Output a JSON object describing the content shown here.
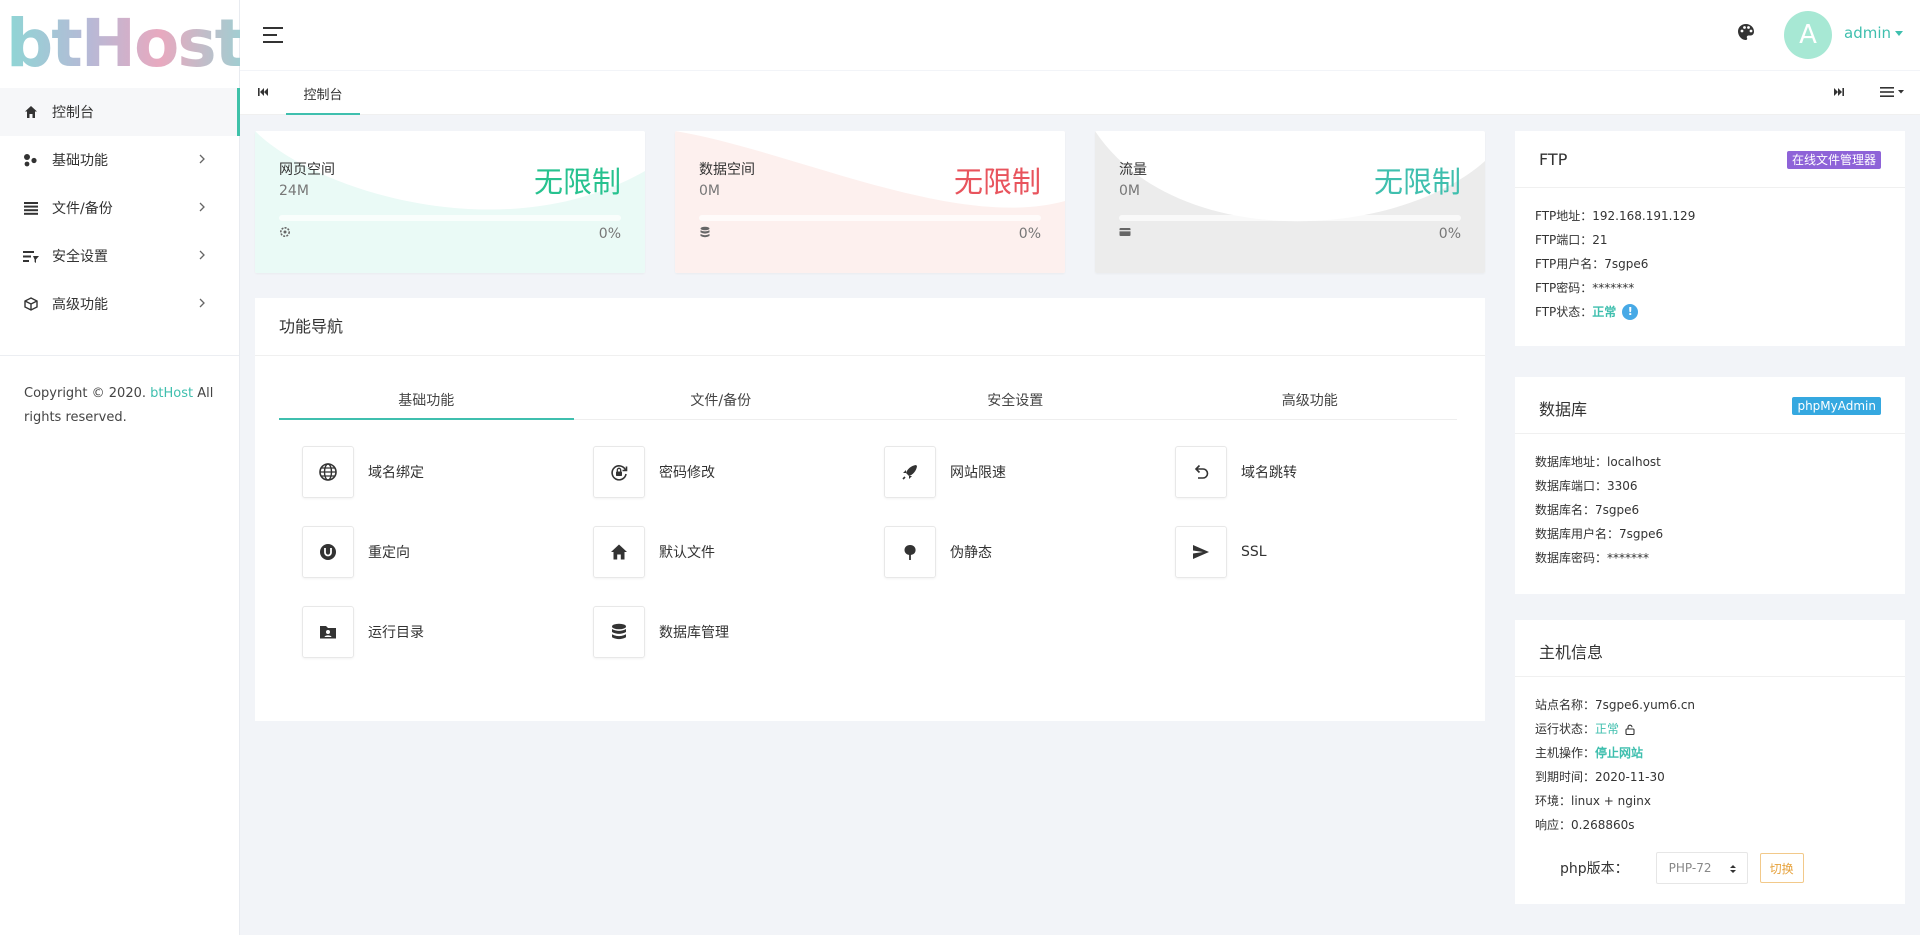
{
  "app": {
    "logo_text": "btHost"
  },
  "sidebar": {
    "items": [
      {
        "label": "控制台",
        "icon": "home-icon",
        "active": true
      },
      {
        "label": "基础功能",
        "icon": "cluster-icon"
      },
      {
        "label": "文件/备份",
        "icon": "list-icon"
      },
      {
        "label": "安全设置",
        "icon": "filter-icon"
      },
      {
        "label": "高级功能",
        "icon": "cube-icon"
      }
    ],
    "copyright": {
      "prefix": "Copyright © 2020. ",
      "brand": "btHost",
      "suffix": " All rights reserved."
    }
  },
  "header": {
    "user": {
      "avatar_letter": "A",
      "name": "admin"
    }
  },
  "tabs": [
    {
      "label": "控制台",
      "active": true
    }
  ],
  "stats": [
    {
      "label": "网页空间",
      "used": "24M",
      "limit": "无限制",
      "percent": "0%",
      "color": "#27c28f",
      "bg": "#eafaf6",
      "icon": "settings-icon"
    },
    {
      "label": "数据空间",
      "used": "0M",
      "limit": "无限制",
      "percent": "0%",
      "color": "#e8545d",
      "bg": "#fdf0ee",
      "icon": "database-icon"
    },
    {
      "label": "流量",
      "used": "0M",
      "limit": "无限制",
      "percent": "0%",
      "color": "#3fbfae",
      "bg": "#ececec",
      "icon": "card-icon"
    }
  ],
  "func_nav": {
    "title": "功能导航",
    "tabs": [
      "基础功能",
      "文件/备份",
      "安全设置",
      "高级功能"
    ],
    "items": [
      {
        "label": "域名绑定",
        "icon": "globe-icon"
      },
      {
        "label": "密码修改",
        "icon": "lock-refresh-icon"
      },
      {
        "label": "网站限速",
        "icon": "rocket-icon"
      },
      {
        "label": "域名跳转",
        "icon": "undo-icon"
      },
      {
        "label": "重定向",
        "icon": "power-icon"
      },
      {
        "label": "默认文件",
        "icon": "home-icon"
      },
      {
        "label": "伪静态",
        "icon": "leaf-icon"
      },
      {
        "label": "SSL",
        "icon": "send-icon"
      },
      {
        "label": "运行目录",
        "icon": "folder-user-icon"
      },
      {
        "label": "数据库管理",
        "icon": "database-icon"
      }
    ]
  },
  "ftp": {
    "title": "FTP",
    "badge": "在线文件管理器",
    "badge_color": "#8e63d8",
    "rows": [
      {
        "label": "FTP地址：",
        "value": "192.168.191.129"
      },
      {
        "label": "FTP端口：",
        "value": "21"
      },
      {
        "label": "FTP用户名：",
        "value": "7sgpe6"
      },
      {
        "label": "FTP密码：",
        "value": "*******"
      }
    ],
    "status_label": "FTP状态：",
    "status_value": "正常",
    "status_info": "!"
  },
  "database": {
    "title": "数据库",
    "badge": "phpMyAdmin",
    "badge_color": "#35a8e0",
    "rows": [
      {
        "label": "数据库地址：",
        "value": "localhost"
      },
      {
        "label": "数据库端口：",
        "value": "3306"
      },
      {
        "label": "数据库名：",
        "value": "7sgpe6"
      },
      {
        "label": "数据库用户名：",
        "value": "7sgpe6"
      },
      {
        "label": "数据库密码：",
        "value": "*******"
      }
    ]
  },
  "host": {
    "title": "主机信息",
    "site_label": "站点名称：",
    "site_value": "7sgpe6.yum6.cn",
    "status_label": "运行状态：",
    "status_value": "正常",
    "op_label": "主机操作：",
    "op_value": "停止网站",
    "expire_label": "到期时间：",
    "expire_value": "2020-11-30",
    "env_label": "环境：",
    "env_value": "linux + nginx",
    "resp_label": "响应：",
    "resp_value": "0.268860s",
    "php_label": "php版本：",
    "php_selected": "PHP-72",
    "php_switch": "切换"
  }
}
